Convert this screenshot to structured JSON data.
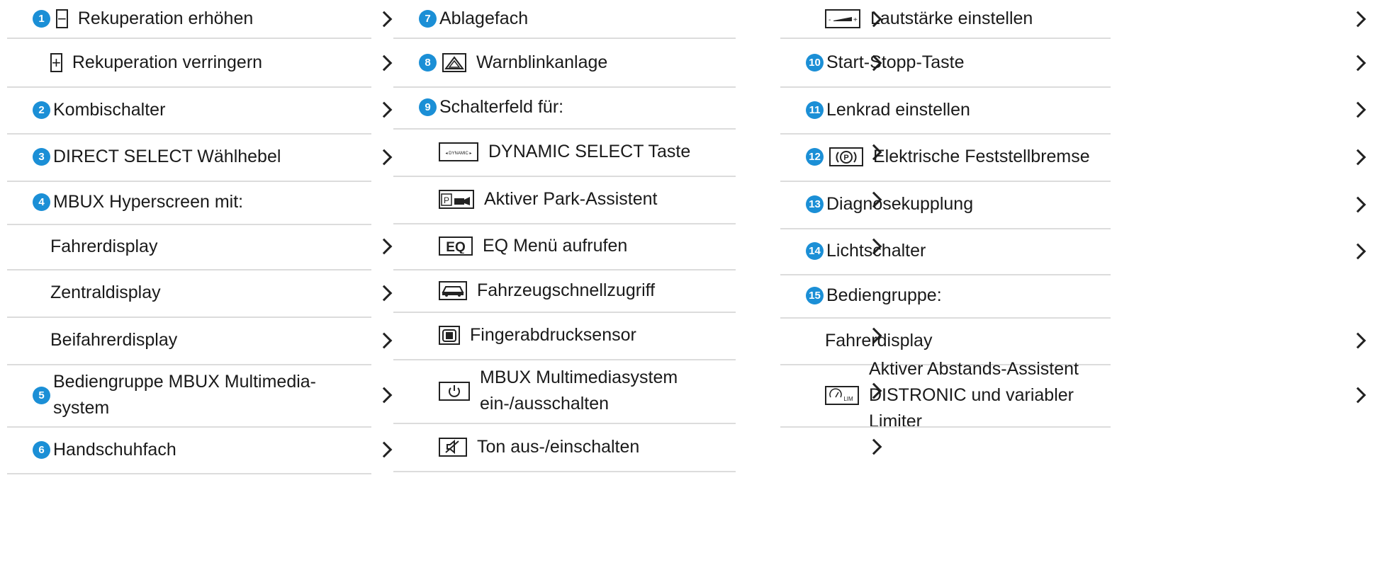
{
  "accent_color": "#1b8fd6",
  "columns": [
    {
      "items": [
        {
          "num": "1",
          "symbol": "minus-symbol",
          "symbol_text": "−",
          "text": "Rekuperation erhöhen",
          "chevron": true
        },
        {
          "symbol": "plus-symbol",
          "symbol_text": "+",
          "text": "Rekuperation verringern",
          "chevron": true
        },
        {
          "num": "2",
          "text": "Kombischalter",
          "chevron": true
        },
        {
          "num": "3",
          "text": "DIRECT SELECT Wählhebel",
          "chevron": true
        },
        {
          "num": "4",
          "text": "MBUX Hyperscreen mit:",
          "chevron": false
        },
        {
          "text": "Fahrerdisplay",
          "chevron": true
        },
        {
          "text": "Zentraldisplay",
          "chevron": true
        },
        {
          "text": "Beifahrerdisplay",
          "chevron": true
        },
        {
          "num": "5",
          "text": "Bediengruppe MBUX Multimedia-",
          "text2": "system",
          "chevron": true
        },
        {
          "num": "6",
          "text": "Handschuhfach",
          "chevron": true
        }
      ]
    },
    {
      "items": [
        {
          "num": "7",
          "text": "Ablagefach",
          "chevron": true
        },
        {
          "num": "8",
          "symbol": "hazard-symbol",
          "text": "Warnblinkanlage",
          "chevron": true
        },
        {
          "num": "9",
          "text": "Schalterfeld für:",
          "chevron": false
        },
        {
          "symbol": "dynamic-select-symbol",
          "symbol_text": "DYNAMIC",
          "text": "DYNAMIC SELECT Taste",
          "chevron": true
        },
        {
          "symbol": "park-assist-symbol",
          "symbol_text": "P",
          "text": "Aktiver Park-Assistent",
          "chevron": true
        },
        {
          "symbol": "eq-symbol",
          "symbol_text": "EQ",
          "text": "EQ Menü aufrufen",
          "chevron": true
        },
        {
          "symbol": "car-symbol",
          "text": "Fahrzeugschnellzugriff",
          "chevron": false
        },
        {
          "symbol": "fingerprint-symbol",
          "text": "Fingerabdrucksensor",
          "chevron": true
        },
        {
          "symbol": "power-symbol",
          "text": "MBUX Multimediasystem",
          "text2": "ein-/ausschalten",
          "chevron": true
        },
        {
          "symbol": "mute-symbol",
          "text": "Ton aus-/einschalten",
          "chevron": true
        }
      ]
    },
    {
      "items": [
        {
          "symbol": "volume-symbol",
          "text": "Lautstärke einstellen",
          "chevron": true
        },
        {
          "num": "10",
          "text": "Start-Stopp-Taste",
          "chevron": true
        },
        {
          "num": "11",
          "text": "Lenkrad einstellen",
          "chevron": true
        },
        {
          "num": "12",
          "symbol": "parking-brake-symbol",
          "symbol_text": "(P)",
          "text": "Elektrische Feststellbremse",
          "chevron": true
        },
        {
          "num": "13",
          "text": "Diagnosekupplung",
          "chevron": true
        },
        {
          "num": "14",
          "text": "Lichtschalter",
          "chevron": true
        },
        {
          "num": "15",
          "text": "Bediengruppe:",
          "chevron": false
        },
        {
          "text": "Fahrerdisplay",
          "chevron": true
        },
        {
          "symbol": "distronic-symbol",
          "symbol_text": "LIM",
          "text": "Aktiver Abstands-Assistent",
          "text2": "DISTRONIC und variabler Limiter",
          "chevron": true
        }
      ]
    }
  ]
}
